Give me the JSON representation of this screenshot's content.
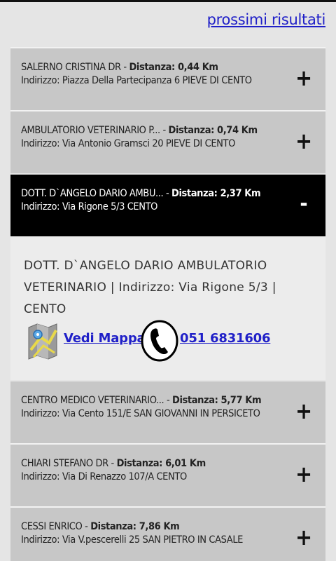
{
  "header": {
    "next_results_label": "prossimi risultati"
  },
  "results": [
    {
      "name": "SALERNO CRISTINA DR - ",
      "distance": "Distanza: 0,44 Km",
      "address": "Indirizzo: Piazza Della Partecipanza 6 PIEVE DI CENTO",
      "toggle": "+"
    },
    {
      "name": "AMBULATORIO VETERINARIO P... - ",
      "distance": "Distanza: 0,74 Km",
      "address": "Indirizzo: Via Antonio Gramsci 20 PIEVE DI CENTO",
      "toggle": "+"
    },
    {
      "name": "DOTT. D`ANGELO DARIO AMBU... - ",
      "distance": "Distanza: 2,37 Km",
      "address": "Indirizzo: Via Rigone 5/3 CENTO",
      "toggle": "-"
    },
    {
      "name": "CENTRO MEDICO VETERINARIO... - ",
      "distance": "Distanza: 5,77 Km",
      "address": "Indirizzo: Via Cento 151/E SAN GIOVANNI IN PERSICETO",
      "toggle": "+"
    },
    {
      "name": "CHIARI STEFANO DR - ",
      "distance": "Distanza: 6,01 Km",
      "address": "Indirizzo: Via Di Renazzo 107/A CENTO",
      "toggle": "+"
    },
    {
      "name": "CESSI ENRICO - ",
      "distance": "Distanza: 7,86 Km",
      "address": "Indirizzo: Via V.pescerelli 25 SAN PIETRO IN CASALE",
      "toggle": "+"
    }
  ],
  "detail": {
    "text": "DOTT. D`ANGELO DARIO AMBULATORIO VETERINARIO | Indirizzo: Via Rigone 5/3 | CENTO",
    "map_label": "Vedi Mappa",
    "phone": "051 6831606",
    "map_icon": "map-icon",
    "phone_icon": "phone-icon"
  },
  "colors": {
    "background": "#e5e5e5",
    "item_background": "#c7c7c7",
    "active_background": "#000000",
    "link": "#2020c8"
  }
}
